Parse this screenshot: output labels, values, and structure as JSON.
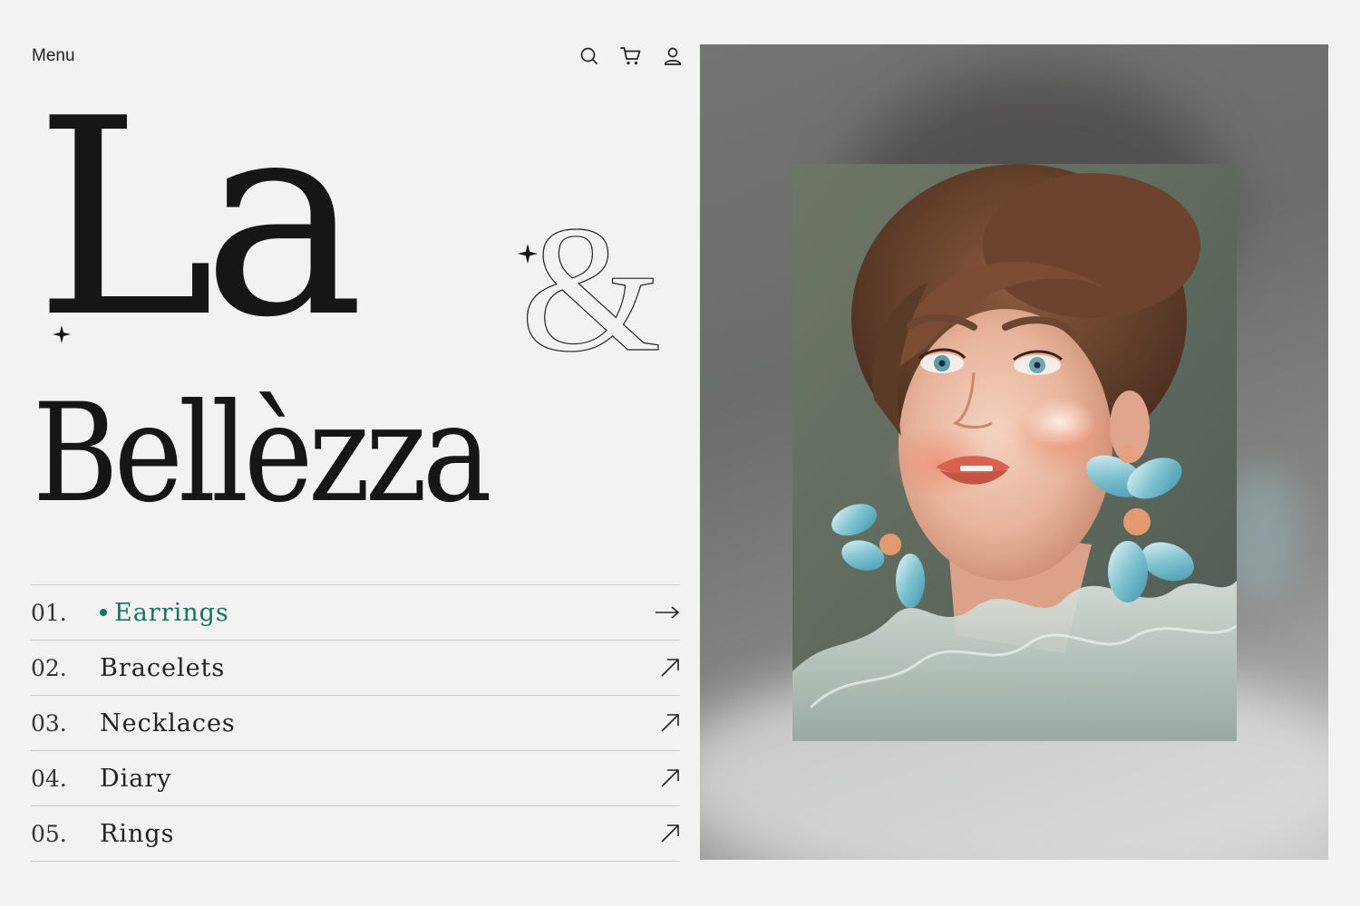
{
  "header": {
    "menu_label": "Menu",
    "icons": [
      "search-icon",
      "cart-icon",
      "user-icon"
    ]
  },
  "brand": {
    "line1": "La",
    "ampersand": "&",
    "line2": "Bellèzza"
  },
  "nav": {
    "items": [
      {
        "number": "01.",
        "label": "Earrings",
        "active": true,
        "arrow": "arrow-right-icon"
      },
      {
        "number": "02.",
        "label": "Bracelets",
        "active": false,
        "arrow": "arrow-up-right-icon"
      },
      {
        "number": "03.",
        "label": "Necklaces",
        "active": false,
        "arrow": "arrow-up-right-icon"
      },
      {
        "number": "04.",
        "label": "Diary",
        "active": false,
        "arrow": "arrow-up-right-icon"
      },
      {
        "number": "05.",
        "label": "Rings",
        "active": false,
        "arrow": "arrow-up-right-icon"
      }
    ]
  },
  "colors": {
    "background": "#f2f2f2",
    "text": "#1a1a1a",
    "accent": "#17725f",
    "divider": "#c9c9c9"
  }
}
